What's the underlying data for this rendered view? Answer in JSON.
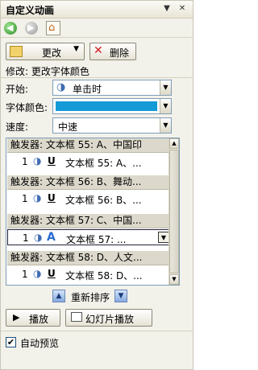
{
  "panel": {
    "title": "自定义动画"
  },
  "toolbar": {
    "change_label": "更改",
    "delete_label": "删除"
  },
  "modify_text": "修改: 更改字体颜色",
  "fields": {
    "start": {
      "label": "开始:",
      "value": "单击时"
    },
    "font_color": {
      "label": "字体颜色:",
      "value_color": "#149ad6"
    },
    "speed": {
      "label": "速度:",
      "value": "中速"
    }
  },
  "animation_list": [
    {
      "trigger": "触发器: 文本框 55: A、中国印",
      "effect_num": "1",
      "effect_icon": "underline-icon",
      "effect_text": "文本框 55: A、..."
    },
    {
      "trigger": "触发器: 文本框 56: B、舞动...",
      "effect_num": "1",
      "effect_icon": "underline-icon",
      "effect_text": "文本框 56: B、..."
    },
    {
      "trigger": "触发器: 文本框 57: C、中国...",
      "effect_num": "1",
      "effect_icon": "font-color-icon",
      "effect_text": "文本框 57: ..."
    },
    {
      "trigger": "触发器: 文本框 58: D、人文...",
      "effect_num": "1",
      "effect_icon": "underline-icon",
      "effect_text": "文本框 58: D、..."
    }
  ],
  "reorder_label": "重新排序",
  "buttons": {
    "play_label": "播放",
    "slideshow_label": "幻灯片播放"
  },
  "autopreview": {
    "label": "自动预览",
    "checked": true
  },
  "colors": {
    "accent": "#149ad6"
  }
}
